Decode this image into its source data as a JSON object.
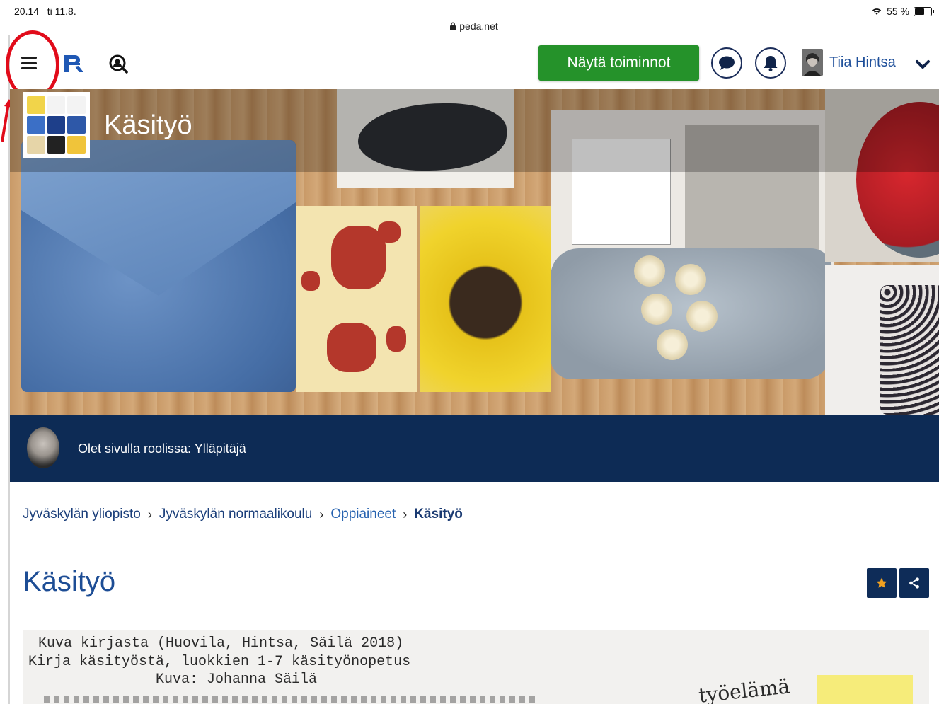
{
  "status_bar": {
    "time": "20.14",
    "date": "ti 11.8.",
    "battery": "55 %"
  },
  "browser": {
    "url": "peda.net"
  },
  "header": {
    "actions_button": "Näytä toiminnot",
    "user_name": "Tiia Hintsa"
  },
  "banner": {
    "title": "Käsityö"
  },
  "role": {
    "text": "Olet sivulla roolissa: Ylläpitäjä"
  },
  "breadcrumb": [
    "Jyväskylän yliopisto",
    "Jyväskylän normaalikoulu",
    "Oppiaineet",
    "Käsityö"
  ],
  "page": {
    "title": "Käsityö"
  },
  "scan_image": {
    "line1": "Kuva kirjasta (Huovila, Hintsa, Säilä 2018)",
    "line2": "Kirja käsityöstä, luokkien 1-7 käsityönopetus",
    "line3": "Kuva: Johanna Säilä",
    "word": "työelämä"
  },
  "colors": {
    "action_green": "#25922a",
    "navy": "#0d2b55",
    "link_blue": "#1d4d95",
    "annotation_red": "#e10b1a",
    "favorite_orange": "#f0a020"
  },
  "icons": {
    "menu": "hamburger-icon",
    "logo": "peda-logo-icon",
    "search": "user-search-icon",
    "chat": "chat-bubble-icon",
    "notifications": "bell-icon",
    "dropdown": "chevron-down-icon",
    "favorite": "star-icon",
    "share": "share-icon"
  }
}
